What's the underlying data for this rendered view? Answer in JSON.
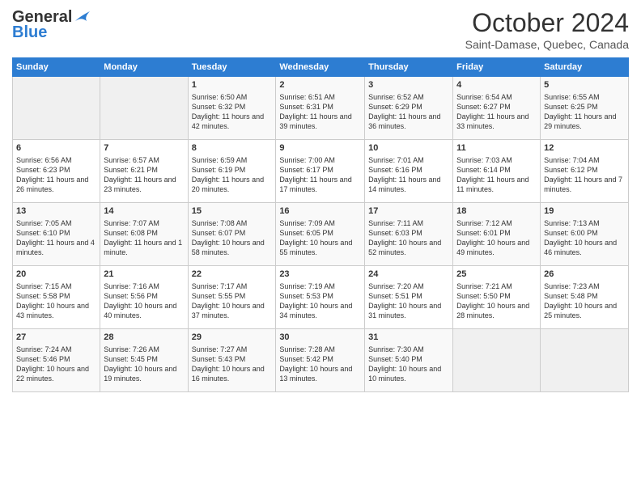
{
  "header": {
    "logo_general": "General",
    "logo_blue": "Blue",
    "month": "October 2024",
    "location": "Saint-Damase, Quebec, Canada"
  },
  "weekdays": [
    "Sunday",
    "Monday",
    "Tuesday",
    "Wednesday",
    "Thursday",
    "Friday",
    "Saturday"
  ],
  "weeks": [
    [
      {
        "day": "",
        "info": ""
      },
      {
        "day": "",
        "info": ""
      },
      {
        "day": "1",
        "info": "Sunrise: 6:50 AM\nSunset: 6:32 PM\nDaylight: 11 hours and 42 minutes."
      },
      {
        "day": "2",
        "info": "Sunrise: 6:51 AM\nSunset: 6:31 PM\nDaylight: 11 hours and 39 minutes."
      },
      {
        "day": "3",
        "info": "Sunrise: 6:52 AM\nSunset: 6:29 PM\nDaylight: 11 hours and 36 minutes."
      },
      {
        "day": "4",
        "info": "Sunrise: 6:54 AM\nSunset: 6:27 PM\nDaylight: 11 hours and 33 minutes."
      },
      {
        "day": "5",
        "info": "Sunrise: 6:55 AM\nSunset: 6:25 PM\nDaylight: 11 hours and 29 minutes."
      }
    ],
    [
      {
        "day": "6",
        "info": "Sunrise: 6:56 AM\nSunset: 6:23 PM\nDaylight: 11 hours and 26 minutes."
      },
      {
        "day": "7",
        "info": "Sunrise: 6:57 AM\nSunset: 6:21 PM\nDaylight: 11 hours and 23 minutes."
      },
      {
        "day": "8",
        "info": "Sunrise: 6:59 AM\nSunset: 6:19 PM\nDaylight: 11 hours and 20 minutes."
      },
      {
        "day": "9",
        "info": "Sunrise: 7:00 AM\nSunset: 6:17 PM\nDaylight: 11 hours and 17 minutes."
      },
      {
        "day": "10",
        "info": "Sunrise: 7:01 AM\nSunset: 6:16 PM\nDaylight: 11 hours and 14 minutes."
      },
      {
        "day": "11",
        "info": "Sunrise: 7:03 AM\nSunset: 6:14 PM\nDaylight: 11 hours and 11 minutes."
      },
      {
        "day": "12",
        "info": "Sunrise: 7:04 AM\nSunset: 6:12 PM\nDaylight: 11 hours and 7 minutes."
      }
    ],
    [
      {
        "day": "13",
        "info": "Sunrise: 7:05 AM\nSunset: 6:10 PM\nDaylight: 11 hours and 4 minutes."
      },
      {
        "day": "14",
        "info": "Sunrise: 7:07 AM\nSunset: 6:08 PM\nDaylight: 11 hours and 1 minute."
      },
      {
        "day": "15",
        "info": "Sunrise: 7:08 AM\nSunset: 6:07 PM\nDaylight: 10 hours and 58 minutes."
      },
      {
        "day": "16",
        "info": "Sunrise: 7:09 AM\nSunset: 6:05 PM\nDaylight: 10 hours and 55 minutes."
      },
      {
        "day": "17",
        "info": "Sunrise: 7:11 AM\nSunset: 6:03 PM\nDaylight: 10 hours and 52 minutes."
      },
      {
        "day": "18",
        "info": "Sunrise: 7:12 AM\nSunset: 6:01 PM\nDaylight: 10 hours and 49 minutes."
      },
      {
        "day": "19",
        "info": "Sunrise: 7:13 AM\nSunset: 6:00 PM\nDaylight: 10 hours and 46 minutes."
      }
    ],
    [
      {
        "day": "20",
        "info": "Sunrise: 7:15 AM\nSunset: 5:58 PM\nDaylight: 10 hours and 43 minutes."
      },
      {
        "day": "21",
        "info": "Sunrise: 7:16 AM\nSunset: 5:56 PM\nDaylight: 10 hours and 40 minutes."
      },
      {
        "day": "22",
        "info": "Sunrise: 7:17 AM\nSunset: 5:55 PM\nDaylight: 10 hours and 37 minutes."
      },
      {
        "day": "23",
        "info": "Sunrise: 7:19 AM\nSunset: 5:53 PM\nDaylight: 10 hours and 34 minutes."
      },
      {
        "day": "24",
        "info": "Sunrise: 7:20 AM\nSunset: 5:51 PM\nDaylight: 10 hours and 31 minutes."
      },
      {
        "day": "25",
        "info": "Sunrise: 7:21 AM\nSunset: 5:50 PM\nDaylight: 10 hours and 28 minutes."
      },
      {
        "day": "26",
        "info": "Sunrise: 7:23 AM\nSunset: 5:48 PM\nDaylight: 10 hours and 25 minutes."
      }
    ],
    [
      {
        "day": "27",
        "info": "Sunrise: 7:24 AM\nSunset: 5:46 PM\nDaylight: 10 hours and 22 minutes."
      },
      {
        "day": "28",
        "info": "Sunrise: 7:26 AM\nSunset: 5:45 PM\nDaylight: 10 hours and 19 minutes."
      },
      {
        "day": "29",
        "info": "Sunrise: 7:27 AM\nSunset: 5:43 PM\nDaylight: 10 hours and 16 minutes."
      },
      {
        "day": "30",
        "info": "Sunrise: 7:28 AM\nSunset: 5:42 PM\nDaylight: 10 hours and 13 minutes."
      },
      {
        "day": "31",
        "info": "Sunrise: 7:30 AM\nSunset: 5:40 PM\nDaylight: 10 hours and 10 minutes."
      },
      {
        "day": "",
        "info": ""
      },
      {
        "day": "",
        "info": ""
      }
    ]
  ]
}
